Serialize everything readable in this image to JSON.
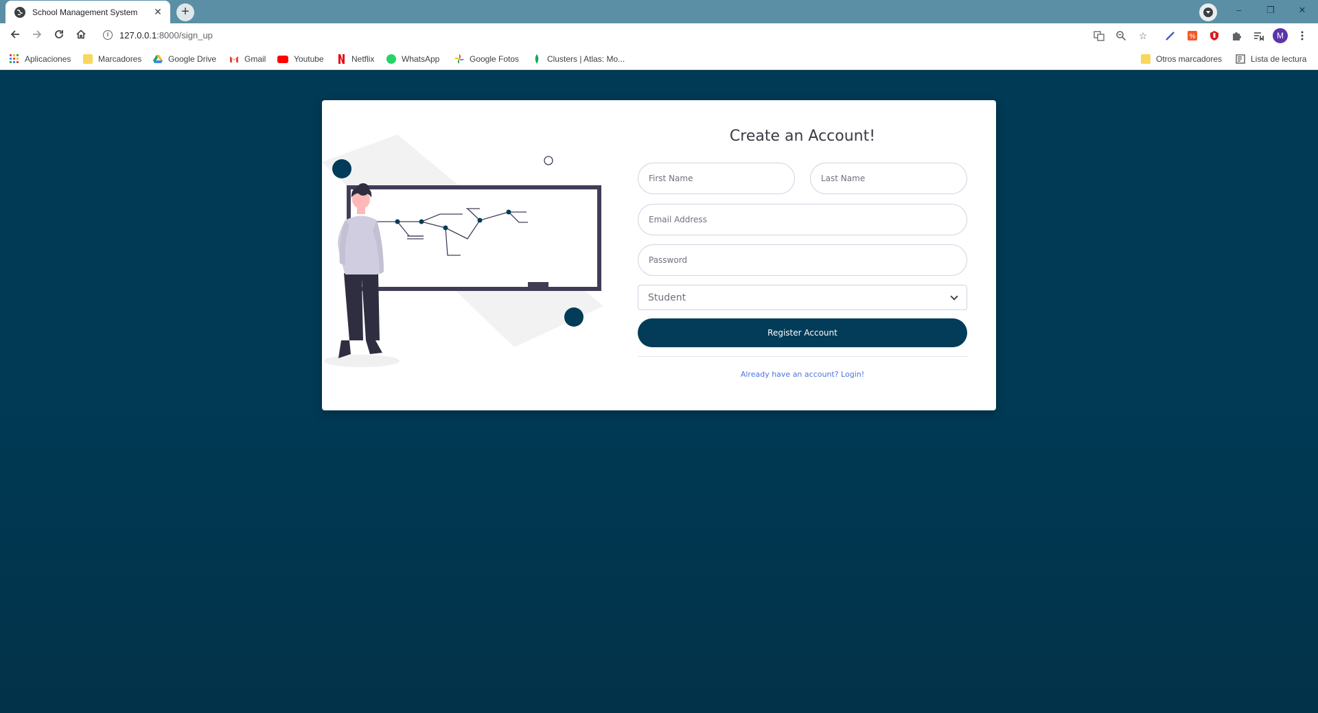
{
  "browser": {
    "tab_title": "School Management System",
    "tab_close": "✕",
    "new_tab": "+",
    "url_host": "127.0.0.1",
    "url_path": ":8000/sign_up",
    "window_controls": {
      "minimize": "–",
      "restore": "❐",
      "close": "✕"
    },
    "avatar_letter": "M",
    "icons": [
      "back-icon",
      "forward-icon",
      "reload-icon",
      "home-icon",
      "info-icon",
      "translate-icon",
      "zoom-icon",
      "star-icon",
      "pen-extension-icon",
      "percent-extension-icon",
      "shield-extension-icon",
      "puzzle-icon",
      "reading-list-icon",
      "menu-icon"
    ]
  },
  "bookmarks": {
    "items": [
      {
        "label": "Aplicaciones",
        "icon": "apps-grid-icon",
        "color": "#e8453c"
      },
      {
        "label": "Marcadores",
        "icon": "folder-icon",
        "color": "#f9d65d"
      },
      {
        "label": "Google Drive",
        "icon": "google-drive-icon",
        "color": "#1fa463"
      },
      {
        "label": "Gmail",
        "icon": "gmail-icon",
        "color": "#ea4335"
      },
      {
        "label": "Youtube",
        "icon": "youtube-icon",
        "color": "#ff0000"
      },
      {
        "label": "Netflix",
        "icon": "netflix-icon",
        "color": "#e50914"
      },
      {
        "label": "WhatsApp",
        "icon": "whatsapp-icon",
        "color": "#25d366"
      },
      {
        "label": "Google Fotos",
        "icon": "google-photos-icon",
        "color": "#fbbc04"
      },
      {
        "label": "Clusters | Atlas: Mo...",
        "icon": "mongodb-leaf-icon",
        "color": "#13aa52"
      }
    ],
    "other": "Otros marcadores",
    "reading_list": "Lista de lectura"
  },
  "form": {
    "title": "Create an Account!",
    "first_name_placeholder": "First Name",
    "last_name_placeholder": "Last Name",
    "email_placeholder": "Email Address",
    "password_placeholder": "Password",
    "role_selected": "Student",
    "register_label": "Register Account",
    "login_link": "Already have an account? Login!"
  },
  "colors": {
    "page_background": "#003b59",
    "primary_button": "#023c58",
    "link": "#4e73df",
    "tab_strip": "#5b8fa6"
  }
}
